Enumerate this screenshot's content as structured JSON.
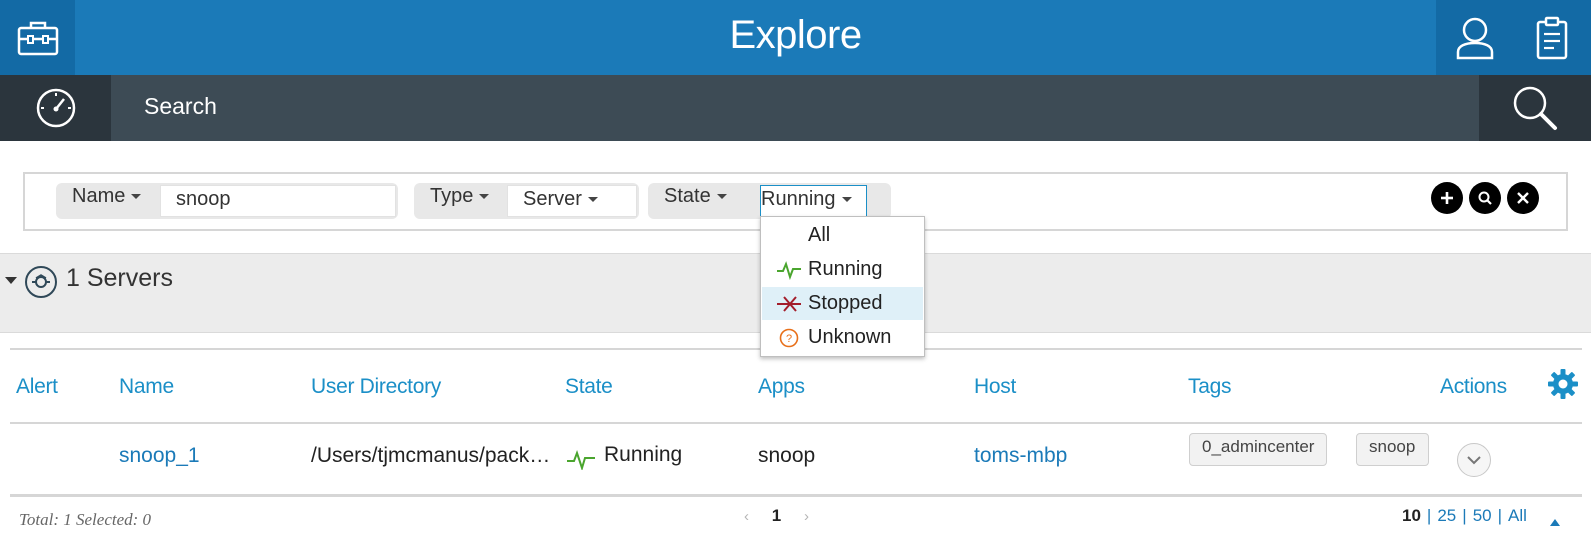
{
  "header": {
    "title": "Explore"
  },
  "searchbar": {
    "label": "Search"
  },
  "filters": {
    "name": {
      "key": "Name",
      "value": "snoop"
    },
    "type": {
      "key": "Type",
      "value": "Server"
    },
    "state": {
      "key": "State",
      "value": "Running"
    }
  },
  "state_menu": {
    "items": [
      {
        "label": "All",
        "icon": ""
      },
      {
        "label": "Running",
        "icon": "running-pulse-icon"
      },
      {
        "label": "Stopped",
        "icon": "stopped-x-icon"
      },
      {
        "label": "Unknown",
        "icon": "unknown-question-icon"
      }
    ],
    "highlighted": "Stopped"
  },
  "section": {
    "title": "1 Servers"
  },
  "table": {
    "columns": [
      "Alert",
      "Name",
      "User Directory",
      "State",
      "Apps",
      "Host",
      "Tags",
      "Actions"
    ],
    "rows": [
      {
        "alert": "",
        "name": "snoop_1",
        "user_directory": "/Users/tjmcmanus/pack…",
        "state": "Running",
        "apps": "snoop",
        "host": "toms-mbp",
        "tags": [
          "0_admincenter",
          "snoop"
        ]
      }
    ]
  },
  "footer": {
    "total": "Total: 1 Selected: 0",
    "page": "1",
    "page_sizes": [
      "10",
      "25",
      "50",
      "All"
    ],
    "current_page_size": "10",
    "prev_arrow": "‹",
    "next_arrow": "›"
  },
  "colors": {
    "header_blue": "#1b7ab8",
    "header_dark_blue": "#136aa5",
    "searchbar": "#3d4b55",
    "link_blue": "#1b8fc7",
    "running_green": "#4aa52e",
    "stopped_red": "#a31d2b",
    "unknown_orange": "#e8701a",
    "highlight": "#dff0f8"
  }
}
